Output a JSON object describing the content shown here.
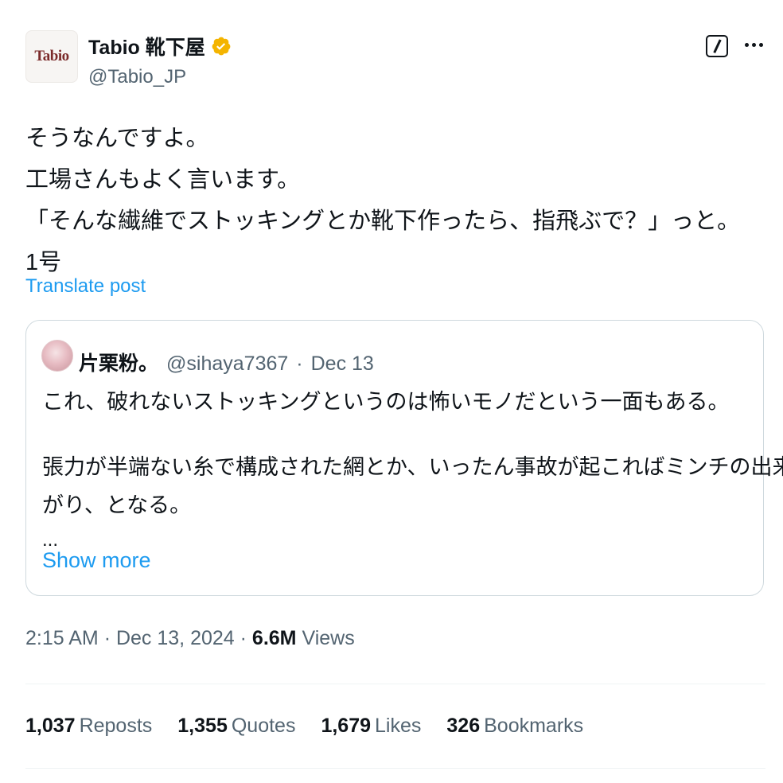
{
  "author": {
    "display_name": "Tabio 靴下屋",
    "handle": "@Tabio_JP",
    "avatar_logo_text": "Tabio",
    "verified_badge": "gold-verified-badge-icon",
    "verified_color": "#f4b400"
  },
  "header_actions": {
    "grok_icon": "grok-icon",
    "more_icon": "more-horizontal-icon"
  },
  "tweet": {
    "lines": [
      "そうなんですよ。",
      "工場さんもよく言います。",
      "「そんな繊維でストッキングとか靴下作ったら、指飛ぶで？」っと。",
      "1号"
    ],
    "translate_label": "Translate post"
  },
  "quote": {
    "author_name": "片栗粉。",
    "author_handle": "@sihaya7367",
    "separator": "·",
    "date": "Dec 13",
    "line1": "これ、破れないストッキングというのは怖いモノだという一面もある。",
    "line2": "張力が半端ない糸で構成された網とか、いったん事故が起こればミンチの出来上",
    "line3": "がり、となる。",
    "ellipsis": "...",
    "show_more_label": "Show more"
  },
  "meta": {
    "time": "2:15 AM",
    "separator": "·",
    "date": "Dec 13, 2024",
    "views_count": "6.6M",
    "views_label": "Views"
  },
  "stats": {
    "reposts": {
      "count": "1,037",
      "label": "Reposts"
    },
    "quotes": {
      "count": "1,355",
      "label": "Quotes"
    },
    "likes": {
      "count": "1,679",
      "label": "Likes"
    },
    "bookmarks": {
      "count": "326",
      "label": "Bookmarks"
    }
  },
  "colors": {
    "text_primary": "#0f1419",
    "text_secondary": "#536471",
    "link": "#1d9bf0",
    "border": "#cfd9de"
  }
}
